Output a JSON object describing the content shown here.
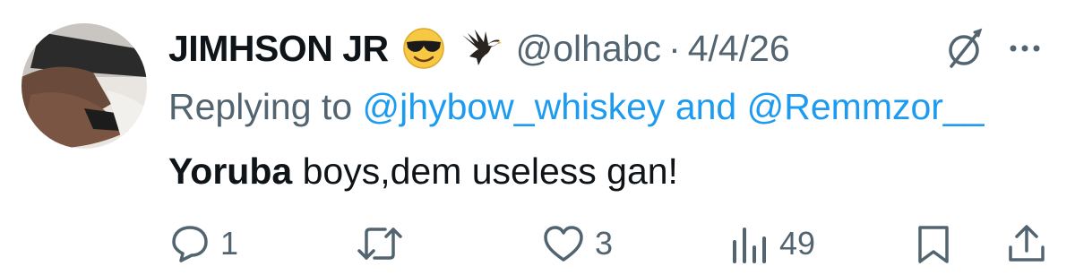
{
  "tweet": {
    "display_name": "JIMHSON JR",
    "emojis": [
      "smiling-face-with-sunglasses-icon",
      "eagle-icon"
    ],
    "handle": "@olhabc",
    "separator": "·",
    "date": "4/4/26",
    "replying_prefix": "Replying to",
    "mentions": [
      "@jhybow_whiskey",
      "@Remmzor__"
    ],
    "mention_joiner": "and",
    "text_bold": "Yoruba",
    "text_rest": " boys,dem useless gan!"
  },
  "actions": {
    "reply_count": "1",
    "retweet_count": "",
    "like_count": "3",
    "views_count": "49"
  },
  "colors": {
    "text": "#0f1419",
    "secondary": "#536471",
    "link": "#1d9bf0"
  },
  "icons": [
    "grok-icon",
    "more-icon",
    "reply-icon",
    "retweet-icon",
    "like-icon",
    "views-icon",
    "bookmark-icon",
    "share-icon"
  ]
}
